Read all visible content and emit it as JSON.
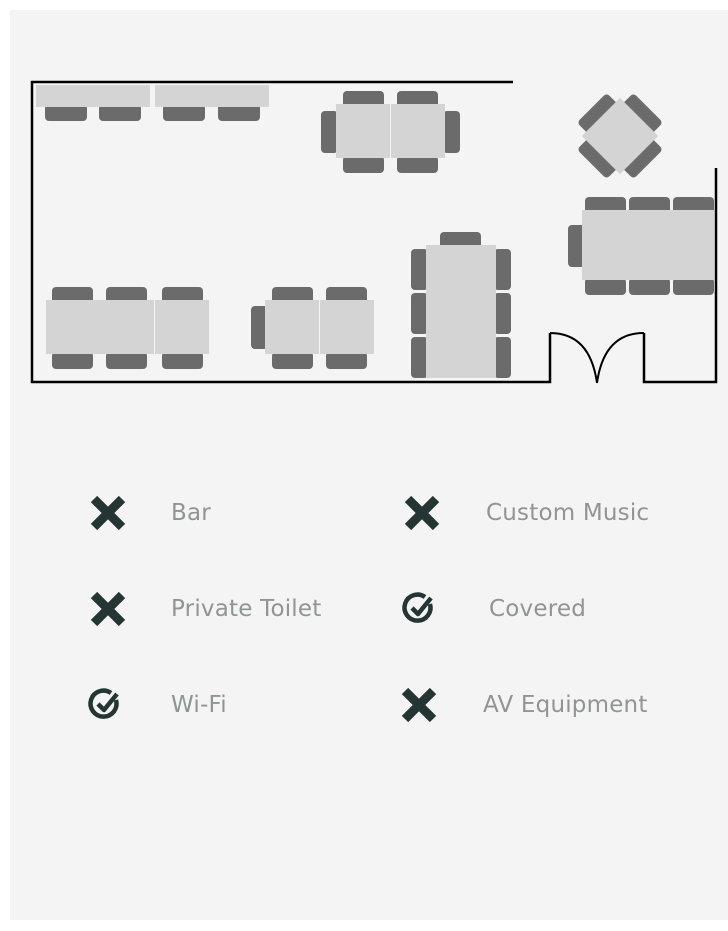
{
  "colors": {
    "background": "#f4f4f4",
    "wall": "#000000",
    "table": "#d4d4d4",
    "chair": "#6b6b6b",
    "icon": "#243534",
    "label": "#8f9494"
  },
  "amenities": [
    {
      "label": "Bar",
      "status": "unavailable",
      "icon": "x-icon"
    },
    {
      "label": "Custom Music",
      "status": "unavailable",
      "icon": "x-icon"
    },
    {
      "label": "Private Toilet",
      "status": "unavailable",
      "icon": "x-icon"
    },
    {
      "label": "Covered",
      "status": "available",
      "icon": "check-circle-icon"
    },
    {
      "label": "Wi-Fi",
      "status": "available",
      "icon": "check-circle-icon"
    },
    {
      "label": "AV Equipment",
      "status": "unavailable",
      "icon": "x-icon"
    }
  ]
}
